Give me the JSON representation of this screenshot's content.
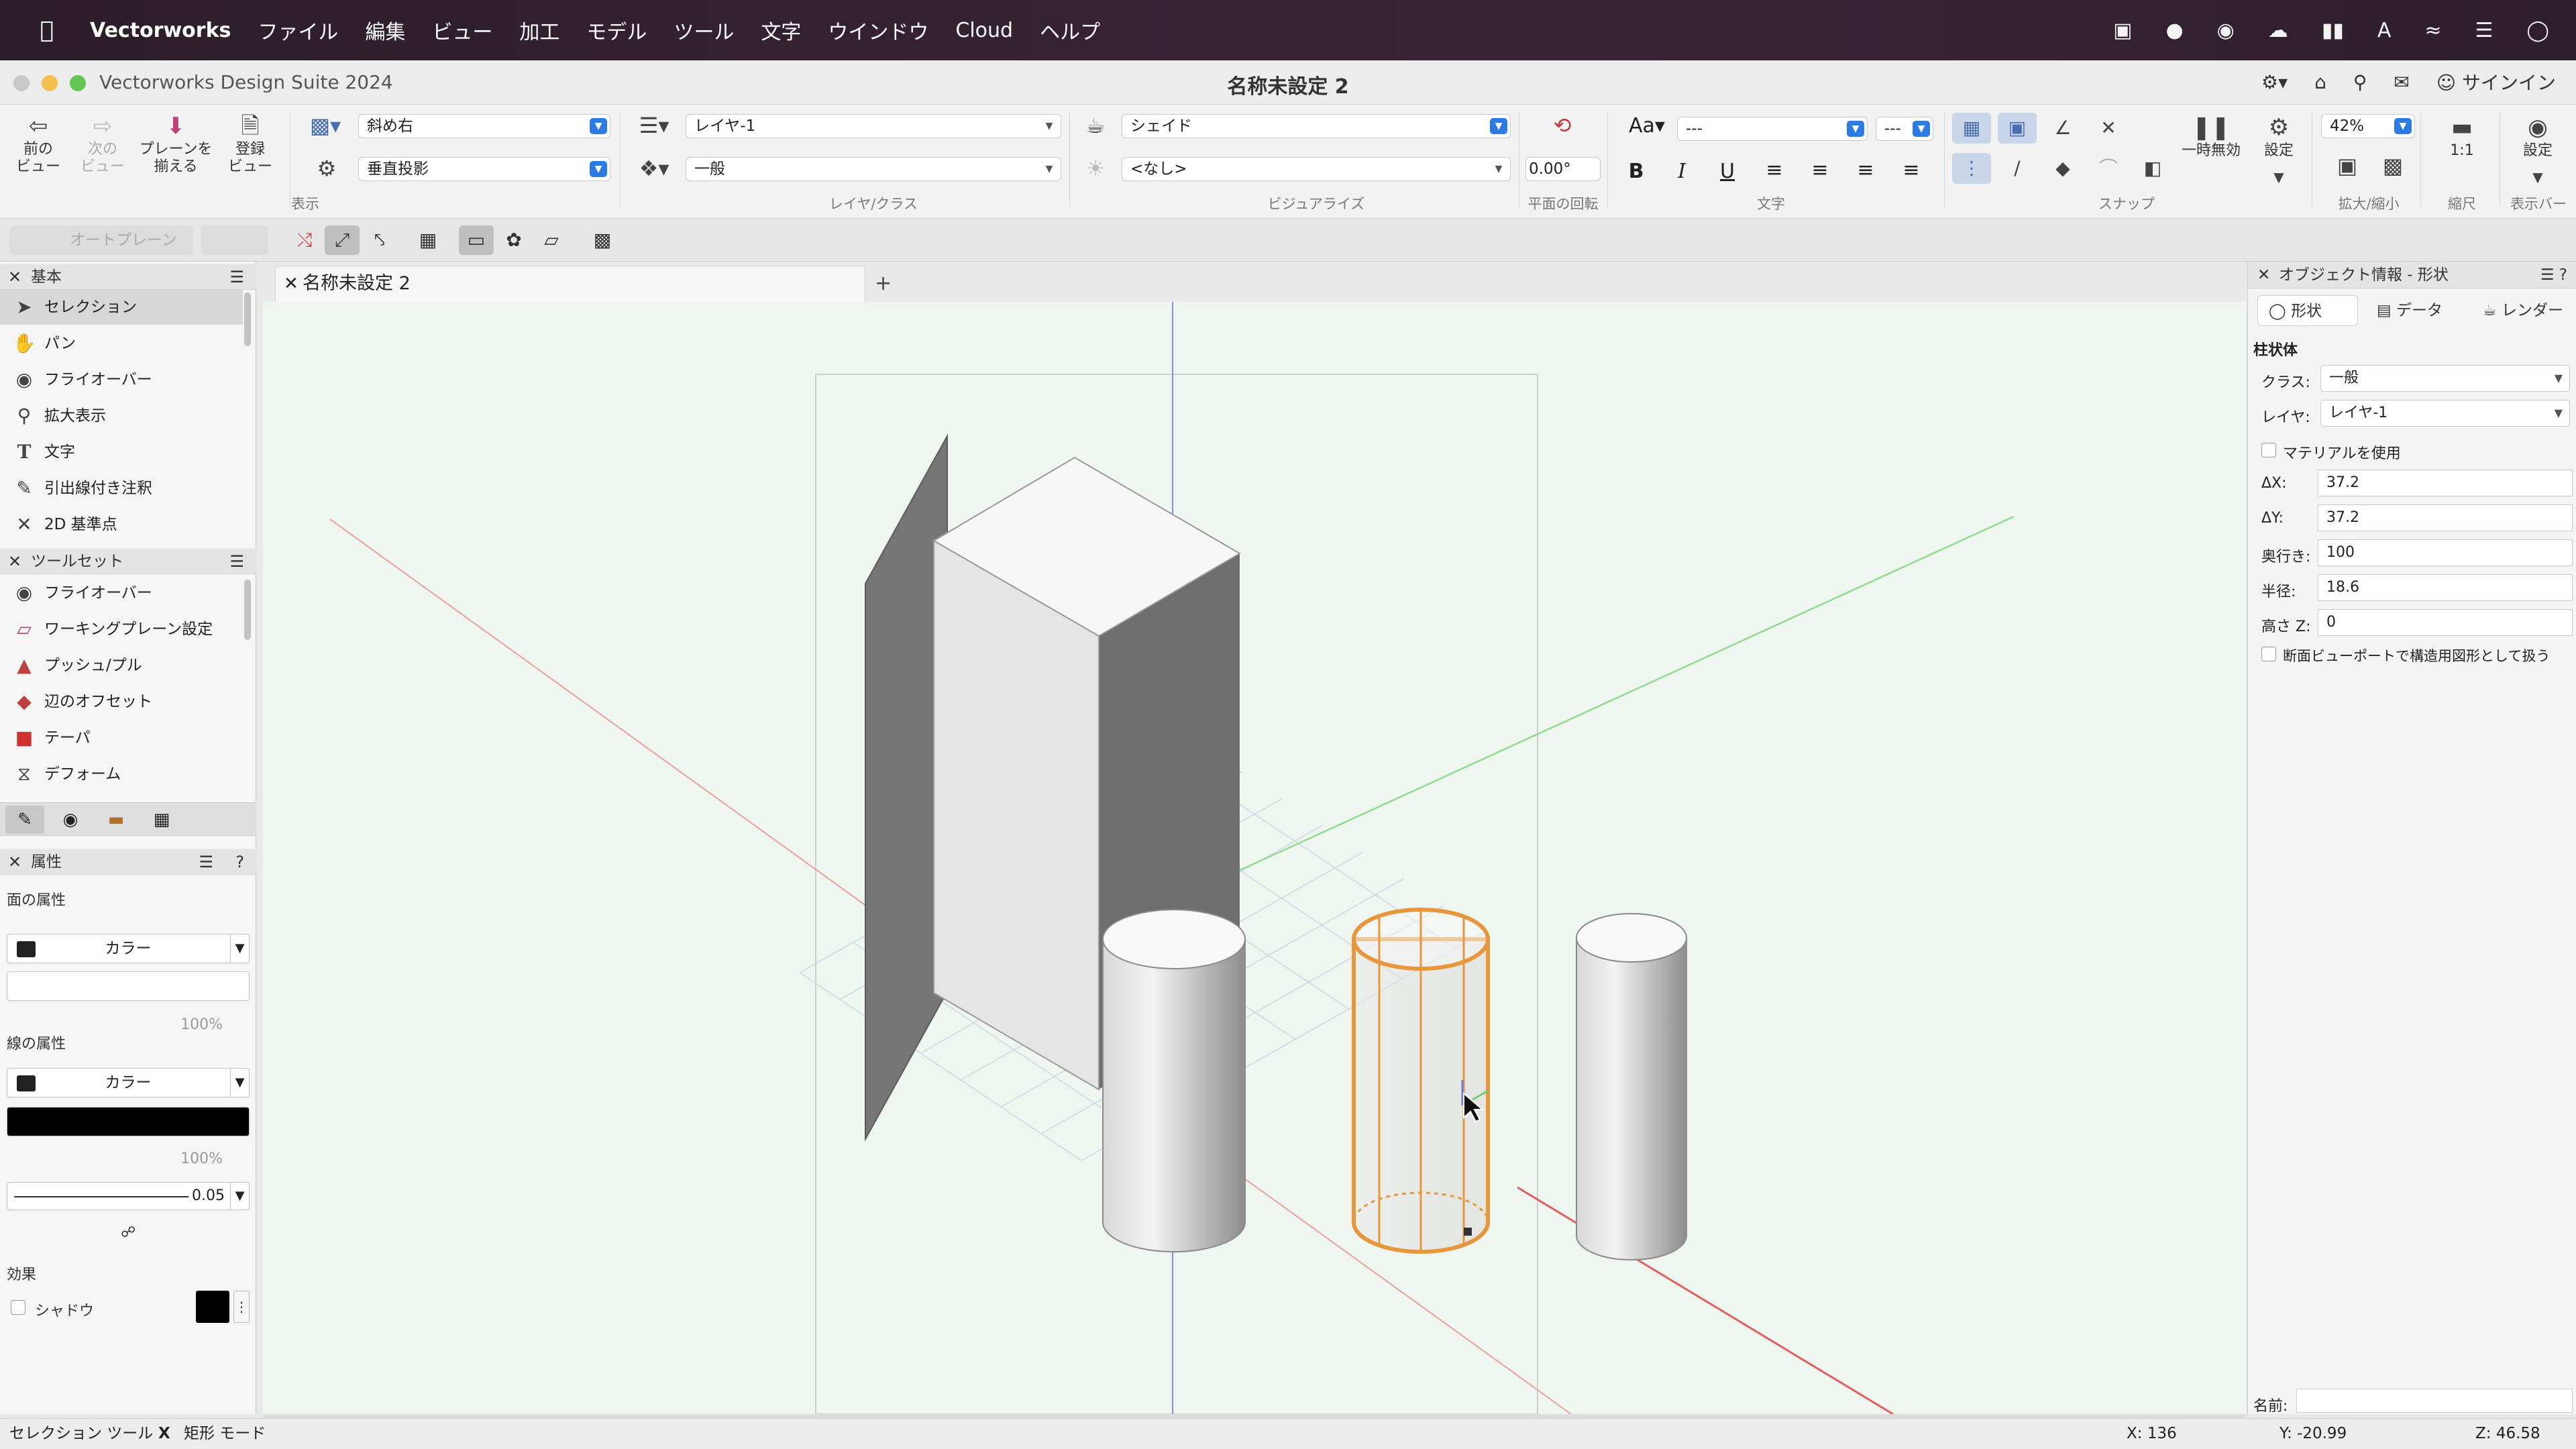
{
  "menubar": {
    "app_name": "Vectorworks",
    "items": [
      "ファイル",
      "編集",
      "ビュー",
      "加工",
      "モデル",
      "ツール",
      "文字",
      "ウインドウ",
      "Cloud",
      "ヘルプ"
    ],
    "status_icons": [
      "screen-record-icon",
      "focus-icon",
      "creative-cloud-icon",
      "cloud-icon",
      "battery-icon",
      "input-method-icon",
      "wifi-icon",
      "control-center-icon",
      "siri-icon"
    ],
    "input_method_letter": "A"
  },
  "window": {
    "app_title": "Vectorworks Design Suite 2024",
    "doc_title": "名称未設定 2",
    "signin": "サインイン"
  },
  "toolbar": {
    "prev_view": "前の\nビュー",
    "next_view": "次の\nビュー",
    "align_plane": "プレーンを\n揃える",
    "saved_view": "登録\nビュー",
    "view_select": "斜め右",
    "projection_select": "垂直投影",
    "view_group": "表示",
    "layer_select": "レイヤ-1",
    "class_select": "一般",
    "layer_class_group": "レイヤ/クラス",
    "render_select": "シェイド",
    "visualize_none": "<なし>",
    "visualize_group": "ビジュアライズ",
    "rotation_value": "0.00°",
    "rotation_group": "平面の回転",
    "font_select": "---",
    "size_select": "---",
    "text_group": "文字",
    "snap_group": "スナップ",
    "pause_label": "一時無効",
    "settings_label": "設定",
    "zoom_value": "42%",
    "zoom_group": "拡大/縮小",
    "scale_label": "1:1",
    "scale_group": "縮尺",
    "display_settings": "設定",
    "displaybar_group": "表示バー"
  },
  "modebar": {
    "autoplane": "オートプレーン"
  },
  "basic_palette": {
    "title": "基本",
    "items": [
      {
        "label": "セレクション",
        "icon": "arrow-icon",
        "active": true
      },
      {
        "label": "パン",
        "icon": "hand-icon",
        "active": false
      },
      {
        "label": "フライオーバー",
        "icon": "flyover-icon",
        "active": false
      },
      {
        "label": "拡大表示",
        "icon": "zoom-icon",
        "active": false
      },
      {
        "label": "文字",
        "icon": "text-icon",
        "active": false
      },
      {
        "label": "引出線付き注釈",
        "icon": "callout-icon",
        "active": false
      },
      {
        "label": "2D 基準点",
        "icon": "locus-icon",
        "active": false
      }
    ]
  },
  "toolset_palette": {
    "title": "ツールセット",
    "items": [
      {
        "label": "フライオーバー",
        "icon": "flyover-icon"
      },
      {
        "label": "ワーキングプレーン設定",
        "icon": "working-plane-icon"
      },
      {
        "label": "プッシュ/プル",
        "icon": "push-pull-icon"
      },
      {
        "label": "辺のオフセット",
        "icon": "offset-edge-icon"
      },
      {
        "label": "テーパ",
        "icon": "taper-icon"
      },
      {
        "label": "デフォーム",
        "icon": "deform-icon"
      }
    ]
  },
  "attributes": {
    "title": "属性",
    "fill_label": "面の属性",
    "fill_type": "カラー",
    "fill_opacity": "100%",
    "line_label": "線の属性",
    "line_type": "カラー",
    "line_opacity": "100%",
    "line_weight": "0.05",
    "effects_label": "効果",
    "shadow_label": "シャドウ"
  },
  "document": {
    "tab_title": "名称未設定 2"
  },
  "oip": {
    "title": "オブジェクト情報 - 形状",
    "tabs": [
      "形状",
      "データ",
      "レンダー"
    ],
    "object_type": "柱状体",
    "class_label": "クラス:",
    "class_value": "一般",
    "layer_label": "レイヤ:",
    "layer_value": "レイヤ-1",
    "material_label": "マテリアルを使用",
    "dx_label": "ΔX:",
    "dx_value": "37.2",
    "dy_label": "ΔY:",
    "dy_value": "37.2",
    "depth_label": "奥行き:",
    "depth_value": "100",
    "radius_label": "半径:",
    "radius_value": "18.6",
    "z_label": "高さ Z:",
    "z_value": "0",
    "section_label": "断面ビューポートで構造用図形として扱う",
    "name_label": "名前:",
    "name_value": ""
  },
  "statusbar": {
    "tool_hint": "セレクション ツール",
    "mode_key": "X",
    "mode_hint": "矩形 モード",
    "x_coord": "X: 136",
    "y_coord": "Y: -20.99",
    "z_coord": "Z: 46.58"
  },
  "colors": {
    "selection_highlight": "#e8963c",
    "accent": "#2c7be5",
    "x_axis": "#e06060",
    "y_axis": "#60c060",
    "z_axis": "#6060e0"
  }
}
